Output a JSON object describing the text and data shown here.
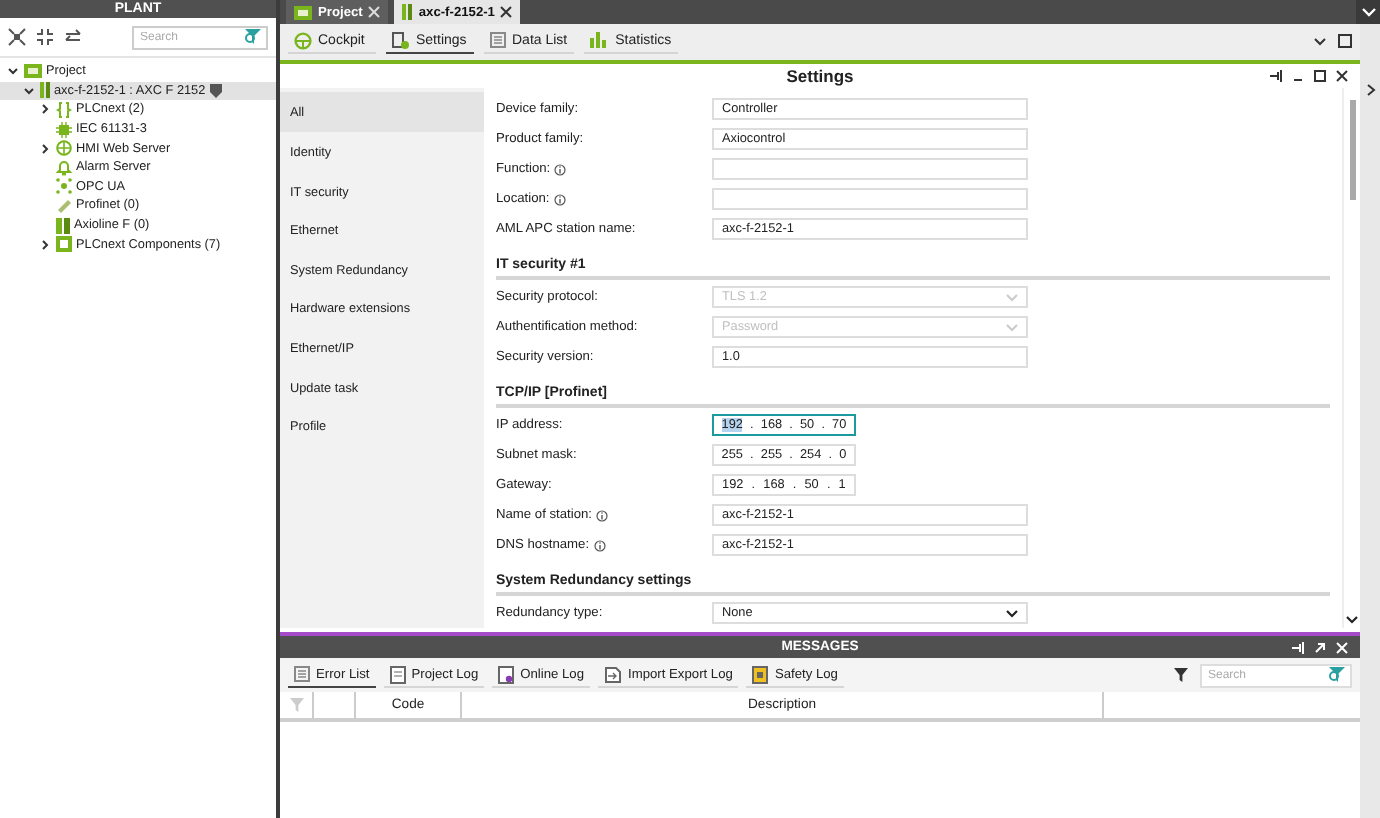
{
  "plant": {
    "title": "PLANT",
    "search": {
      "placeholder": "Search"
    },
    "tree": [
      {
        "label": "Project",
        "kind": "project",
        "expanded": true,
        "selected": false,
        "children": [
          {
            "label": "axc-f-2152-1 : AXC F 2152",
            "kind": "device",
            "expanded": true,
            "selected": true,
            "children": [
              {
                "label": "PLCnext (2)",
                "kind": "plcnext",
                "expanded": false,
                "selected": false
              },
              {
                "label": "IEC 61131-3",
                "kind": "iec",
                "selected": false
              },
              {
                "label": "HMI Web Server",
                "kind": "web",
                "expanded": false,
                "selected": false
              },
              {
                "label": "Alarm Server",
                "kind": "alarm",
                "selected": false
              },
              {
                "label": "OPC UA",
                "kind": "opc",
                "selected": false
              },
              {
                "label": "Profinet (0)",
                "kind": "profinet",
                "selected": false
              },
              {
                "label": "Axioline F (0)",
                "kind": "axioline",
                "selected": false
              },
              {
                "label": "PLCnext Components (7)",
                "kind": "components",
                "expanded": false,
                "selected": false
              }
            ]
          }
        ]
      }
    ]
  },
  "tabs": [
    {
      "label": "Project",
      "kind": "project",
      "selected": false
    },
    {
      "label": "axc-f-2152-1",
      "kind": "device",
      "selected": true
    }
  ],
  "subtabs": [
    {
      "label": "Cockpit",
      "kind": "cockpit",
      "selected": false
    },
    {
      "label": "Settings",
      "kind": "settings",
      "selected": true
    },
    {
      "label": "Data List",
      "kind": "list",
      "selected": false
    },
    {
      "label": "Statistics",
      "kind": "stats",
      "selected": false
    }
  ],
  "settings": {
    "title": "Settings",
    "sections": [
      {
        "label": "All",
        "selected": true
      },
      {
        "label": "Identity",
        "selected": false
      },
      {
        "label": "IT security",
        "selected": false
      },
      {
        "label": "Ethernet",
        "selected": false
      },
      {
        "label": "System Redundancy",
        "selected": false
      },
      {
        "label": "Hardware extensions",
        "selected": false
      },
      {
        "label": "Ethernet/IP",
        "selected": false
      },
      {
        "label": "Update task",
        "selected": false
      },
      {
        "label": "Profile",
        "selected": false
      }
    ],
    "rows": [
      {
        "kind": "text",
        "label": "Device family:",
        "value": "Controller",
        "info": false
      },
      {
        "kind": "text",
        "label": "Product family:",
        "value": "Axiocontrol",
        "info": false
      },
      {
        "kind": "text",
        "label": "Function:",
        "value": "",
        "info": true
      },
      {
        "kind": "text",
        "label": "Location:",
        "value": "",
        "info": true
      },
      {
        "kind": "text",
        "label": "AML APC station name:",
        "value": "axc-f-2152-1",
        "info": false
      },
      {
        "kind": "heading",
        "label": "IT security #1"
      },
      {
        "kind": "select",
        "label": "Security protocol:",
        "value": "TLS 1.2",
        "disabled": true
      },
      {
        "kind": "select",
        "label": "Authentification method:",
        "value": "Password",
        "disabled": true
      },
      {
        "kind": "text",
        "label": "Security version:",
        "value": "1.0",
        "info": false
      },
      {
        "kind": "heading",
        "label": "TCP/IP [Profinet]"
      },
      {
        "kind": "ip",
        "label": "IP address:",
        "separator": ".",
        "focused": true,
        "octets": [
          {
            "text": "192",
            "selected": true
          },
          {
            "text": "168",
            "selected": false
          },
          {
            "text": "50",
            "selected": false
          },
          {
            "text": "70",
            "selected": false
          }
        ]
      },
      {
        "kind": "ip",
        "label": "Subnet mask:",
        "separator": ".",
        "focused": false,
        "octets": [
          {
            "text": "255",
            "selected": false
          },
          {
            "text": "255",
            "selected": false
          },
          {
            "text": "254",
            "selected": false
          },
          {
            "text": "0",
            "selected": false
          }
        ]
      },
      {
        "kind": "ip",
        "label": "Gateway:",
        "separator": ".",
        "focused": false,
        "octets": [
          {
            "text": "192",
            "selected": false
          },
          {
            "text": "168",
            "selected": false
          },
          {
            "text": "50",
            "selected": false
          },
          {
            "text": "1",
            "selected": false
          }
        ]
      },
      {
        "kind": "text",
        "label": "Name of station:",
        "value": "axc-f-2152-1",
        "info": true
      },
      {
        "kind": "text",
        "label": "DNS hostname:",
        "value": "axc-f-2152-1",
        "info": true
      },
      {
        "kind": "heading",
        "label": "System Redundancy settings"
      },
      {
        "kind": "select",
        "label": "Redundancy type:",
        "value": "None",
        "disabled": false
      }
    ]
  },
  "messages": {
    "title": "MESSAGES",
    "tabs": [
      {
        "label": "Error List",
        "kind": "list",
        "selected": true
      },
      {
        "label": "Project Log",
        "kind": "doc",
        "selected": false
      },
      {
        "label": "Online Log",
        "kind": "online",
        "selected": false
      },
      {
        "label": "Import Export Log",
        "kind": "import",
        "selected": false
      },
      {
        "label": "Safety Log",
        "kind": "safety",
        "selected": false
      }
    ],
    "search": {
      "placeholder": "Search"
    },
    "columns": [
      "Code",
      "Description"
    ]
  }
}
